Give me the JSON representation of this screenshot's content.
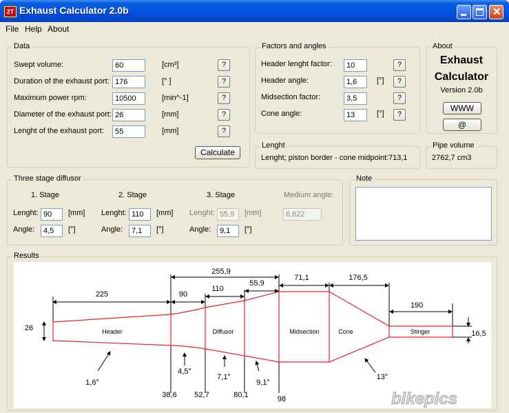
{
  "window": {
    "title": "Exhaust Calculator 2.0b",
    "icon_text": "2T"
  },
  "menu": [
    "File",
    "Help",
    "About"
  ],
  "data_group": {
    "title": "Data",
    "rows": [
      {
        "label": "Swept volume:",
        "value": "60",
        "unit": "[cm³]"
      },
      {
        "label": "Duration of the exhaust port:",
        "value": "176",
        "unit": "[° ]"
      },
      {
        "label": "Maximum power rpm:",
        "value": "10500",
        "unit": "[min^-1]"
      },
      {
        "label": "Diameter of the exhaust port:",
        "value": "26",
        "unit": "[mm]"
      },
      {
        "label": "Lenght of the exhaust port:",
        "value": "55",
        "unit": "[mm]"
      }
    ],
    "help_label": "?",
    "calculate_label": "Calculate"
  },
  "factors_group": {
    "title": "Factors and angles",
    "rows": [
      {
        "label": "Header lenght factor:",
        "value": "10",
        "unit": ""
      },
      {
        "label": "Header angle:",
        "value": "1,6",
        "unit": "[°]"
      },
      {
        "label": "Midsection factor:",
        "value": "3,5",
        "unit": ""
      },
      {
        "label": "Cone angle:",
        "value": "13",
        "unit": "[°]"
      }
    ]
  },
  "about_group": {
    "title": "About",
    "app_line1": "Exhaust",
    "app_line2": "Calculator",
    "version": "Version 2.0b",
    "www_label": "WWW",
    "email_label": "@"
  },
  "lenght_group": {
    "title": "Lenght",
    "text": "Lenght; piston border - cone midpoint:",
    "value": "713,1"
  },
  "pipe_group": {
    "title": "Pipe volume",
    "value": "2762,7 cm3"
  },
  "diffusor_group": {
    "title": "Three stage diffusor",
    "stages": [
      {
        "title": "1. Stage",
        "lenght_label": "Lenght:",
        "lenght": "90",
        "angle_label": "Angle:",
        "angle": "4,5",
        "mm": "[mm]",
        "deg": "[°]"
      },
      {
        "title": "2. Stage",
        "lenght_label": "Lenght:",
        "lenght": "110",
        "angle_label": "Angle:",
        "angle": "7,1",
        "mm": "[mm]",
        "deg": "[°]"
      },
      {
        "title": "3. Stage",
        "lenght_label": "Lenght:",
        "lenght": "55,9",
        "angle_label": "Angle:",
        "angle": "9,1",
        "mm": "[mm]",
        "deg": "[°]"
      }
    ],
    "medium_label": "Medium angle:",
    "medium_value": "6,622"
  },
  "note_group": {
    "title": "Note",
    "text": ""
  },
  "results_group": {
    "title": "Results",
    "sections": [
      "Header",
      "Diffusor",
      "Midsection",
      "Cone",
      "Stinger"
    ],
    "dims_top": [
      "225",
      "90",
      "110",
      "55,9",
      "71,1",
      "176,5",
      "190",
      "255,9"
    ],
    "inlet_diameter": "26",
    "outlet_diameter": "16,5",
    "angles": [
      "1,6°",
      "4,5°",
      "7,1°",
      "9,1°",
      "13°"
    ],
    "diameters": [
      "38,6",
      "52,7",
      "80,1",
      "98"
    ],
    "line_color": "#e8202a"
  },
  "watermark": "bikepics"
}
